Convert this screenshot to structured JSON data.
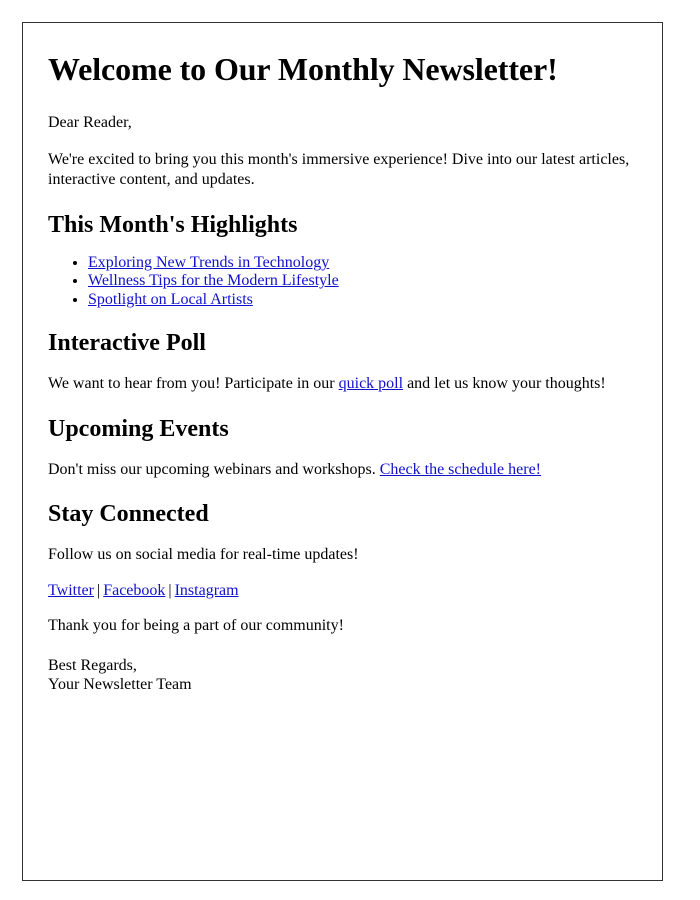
{
  "document": {
    "title": "Welcome to Our Monthly Newsletter!",
    "greeting": "Dear Reader,",
    "intro": "We're excited to bring you this month's immersive experience! Dive into our latest articles, interactive content, and updates."
  },
  "highlights": {
    "heading": "This Month's Highlights",
    "items": [
      "Exploring New Trends in Technology",
      "Wellness Tips for the Modern Lifestyle",
      "Spotlight on Local Artists"
    ]
  },
  "poll": {
    "heading": "Interactive Poll",
    "text_before": "We want to hear from you! Participate in our ",
    "link_label": "quick poll",
    "text_after": " and let us know your thoughts!"
  },
  "events": {
    "heading": "Upcoming Events",
    "text_before": "Don't miss our upcoming webinars and workshops. ",
    "link_label": "Check the schedule here!"
  },
  "stay_connected": {
    "heading": "Stay Connected",
    "follow_text": "Follow us on social media for real-time updates!",
    "social_links": [
      "Twitter",
      "Facebook",
      "Instagram"
    ],
    "separator": "|",
    "thank_you": "Thank you for being a part of our community!",
    "signoff_line1": "Best Regards,",
    "signoff_line2": "Your Newsletter Team"
  },
  "colors": {
    "link": "#1111cc",
    "text": "#000000",
    "border": "#333333",
    "background": "#ffffff"
  }
}
